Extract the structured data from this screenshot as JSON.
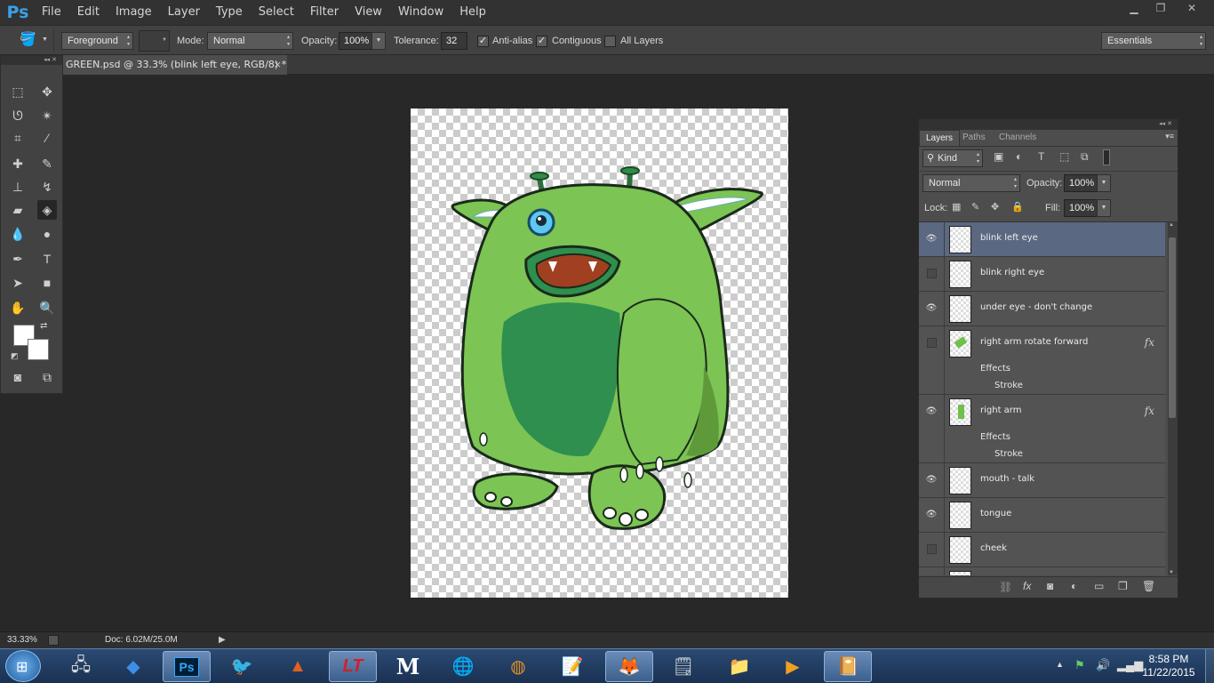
{
  "app": {
    "logo": "Ps"
  },
  "menu": [
    "File",
    "Edit",
    "Image",
    "Layer",
    "Type",
    "Select",
    "Filter",
    "View",
    "Window",
    "Help"
  ],
  "window_controls": {
    "minimize_icon": "minimize-icon",
    "restore_icon": "restore-icon",
    "close_icon": "close-icon"
  },
  "options": {
    "fill_source": "Foreground",
    "mode_label": "Mode:",
    "mode_value": "Normal",
    "opacity_label": "Opacity:",
    "opacity_value": "100%",
    "tolerance_label": "Tolerance:",
    "tolerance_value": "32",
    "antialias_label": "Anti-alias",
    "contiguous_label": "Contiguous",
    "all_layers_label": "All Layers",
    "antialias": true,
    "contiguous": true,
    "all_layers": false,
    "workspace": "Essentials"
  },
  "document": {
    "tab_title": "GREEN.psd @ 33.3% (blink left eye, RGB/8) *",
    "close": "×"
  },
  "status": {
    "zoom": "33.33%",
    "doc_size": "Doc: 6.02M/25.0M"
  },
  "layers_panel": {
    "tabs": [
      "Layers",
      "Paths",
      "Channels"
    ],
    "kind_label": "Kind",
    "blend_mode": "Normal",
    "opacity_label": "Opacity:",
    "opacity_value": "100%",
    "lock_label": "Lock:",
    "fill_label": "Fill:",
    "fill_value": "100%",
    "effects_label": "Effects",
    "stroke_label": "Stroke",
    "layers": [
      {
        "name": "blink left eye",
        "visible": true,
        "selected": true,
        "fx": false
      },
      {
        "name": "blink right eye",
        "visible": false,
        "selected": false,
        "fx": false
      },
      {
        "name": "under eye - don't change",
        "visible": true,
        "selected": false,
        "fx": false
      },
      {
        "name": "right arm rotate forward",
        "visible": false,
        "selected": false,
        "fx": true
      },
      {
        "name": "right arm",
        "visible": true,
        "selected": false,
        "fx": true
      },
      {
        "name": "mouth - talk",
        "visible": true,
        "selected": false,
        "fx": false
      },
      {
        "name": "tongue",
        "visible": true,
        "selected": false,
        "fx": false
      },
      {
        "name": "cheek",
        "visible": false,
        "selected": false,
        "fx": false
      }
    ]
  },
  "taskbar": {
    "time": "8:58 PM",
    "date": "11/22/2015"
  },
  "colors": {
    "accent": "#3aa0e8",
    "selected_layer": "#5b6881",
    "monster_green": "#7cc454",
    "monster_dark": "#2e8f4e"
  }
}
